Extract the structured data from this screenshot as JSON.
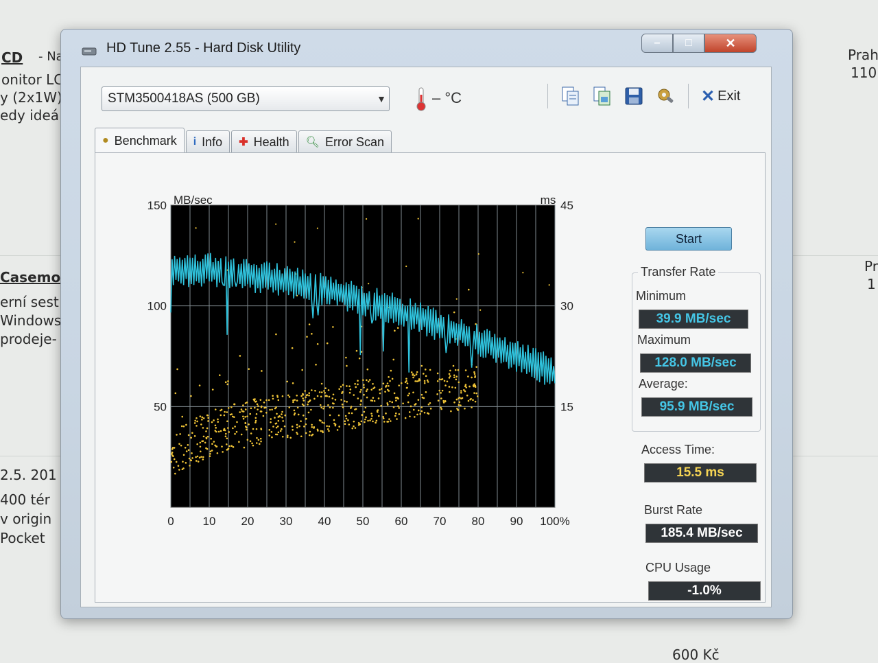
{
  "background_page": {
    "texts": [
      "CD",
      "- Nab",
      "onitor LC",
      "y (2x1W)",
      "edy ideá",
      "Casemod",
      "erní sest",
      "Windows",
      "prodeje-",
      "2.5. 201",
      "400 tér",
      "v origin",
      "Pocket",
      "Prah",
      "110",
      "Pr",
      "1",
      "600 Kč"
    ]
  },
  "window": {
    "title": "HD Tune 2.55 - Hard Disk Utility",
    "controls": {
      "minimize": "–",
      "maximize": "□",
      "close": "✕"
    }
  },
  "toolbar": {
    "drive": "STM3500418AS (500 GB)",
    "temperature": "– °C",
    "exit_label": "Exit",
    "icons": [
      "copy-info-icon",
      "copy-screenshot-icon",
      "save-icon",
      "options-icon"
    ]
  },
  "tabs": [
    {
      "label": "Benchmark",
      "icon": "benchmark-icon",
      "active": true
    },
    {
      "label": "Info",
      "icon": "info-icon",
      "active": false
    },
    {
      "label": "Health",
      "icon": "health-icon",
      "active": false
    },
    {
      "label": "Error Scan",
      "icon": "error-scan-icon",
      "active": false
    }
  ],
  "start_label": "Start",
  "stats": {
    "transfer_rate_title": "Transfer Rate",
    "minimum_label": "Minimum",
    "minimum_value": "39.9 MB/sec",
    "maximum_label": "Maximum",
    "maximum_value": "128.0 MB/sec",
    "average_label": "Average:",
    "average_value": "95.9 MB/sec",
    "access_time_label": "Access Time:",
    "access_time_value": "15.5 ms",
    "burst_rate_label": "Burst Rate",
    "burst_rate_value": "185.4 MB/sec",
    "cpu_usage_label": "CPU Usage",
    "cpu_usage_value": "-1.0%"
  },
  "chart_data": {
    "type": "line",
    "left_axis_label": "MB/sec",
    "right_axis_label": "ms",
    "y_ticks_left": [
      "150",
      "100",
      "50"
    ],
    "y_ticks_right": [
      "45",
      "30",
      "15"
    ],
    "x_ticks": [
      "0",
      "10",
      "20",
      "30",
      "40",
      "50",
      "60",
      "70",
      "80",
      "90",
      "100%"
    ],
    "ylim": [
      0,
      150
    ],
    "y2lim": [
      0,
      45
    ],
    "xlim": [
      0,
      100
    ],
    "grid": true,
    "series": [
      {
        "type": "line",
        "color": "#2fc3dd",
        "x": [
          0,
          5,
          10,
          15,
          20,
          25,
          30,
          35,
          40,
          45,
          50,
          55,
          60,
          65,
          70,
          75,
          80,
          85,
          90,
          95,
          100
        ],
        "y": [
          118,
          117,
          118,
          117,
          115,
          114,
          112,
          110,
          108,
          106,
          103,
          100,
          97,
          94,
          90,
          87,
          83,
          79,
          75,
          71,
          66
        ]
      },
      {
        "type": "scatter",
        "color": "#f0c437",
        "x": [
          0,
          10,
          20,
          30,
          40,
          50,
          60,
          70,
          80
        ],
        "y": [
          8,
          11,
          12.5,
          13.5,
          14.5,
          15.5,
          16.5,
          17.5,
          18.5
        ]
      }
    ]
  }
}
